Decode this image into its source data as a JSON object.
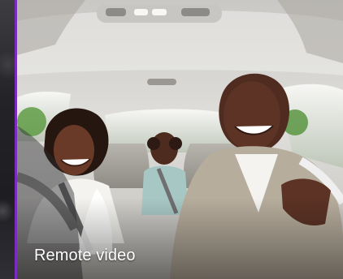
{
  "caption": {
    "line1": "Remote video"
  },
  "palette": {
    "accent": "#7b2cbf",
    "ceiling": "#d9d8d4",
    "skin_dark": "#5b3526",
    "shirt_white": "#f3f2ef",
    "shirt_khaki": "#b7ad9d"
  },
  "icons": {
    "accent": "purple-accent-line"
  }
}
